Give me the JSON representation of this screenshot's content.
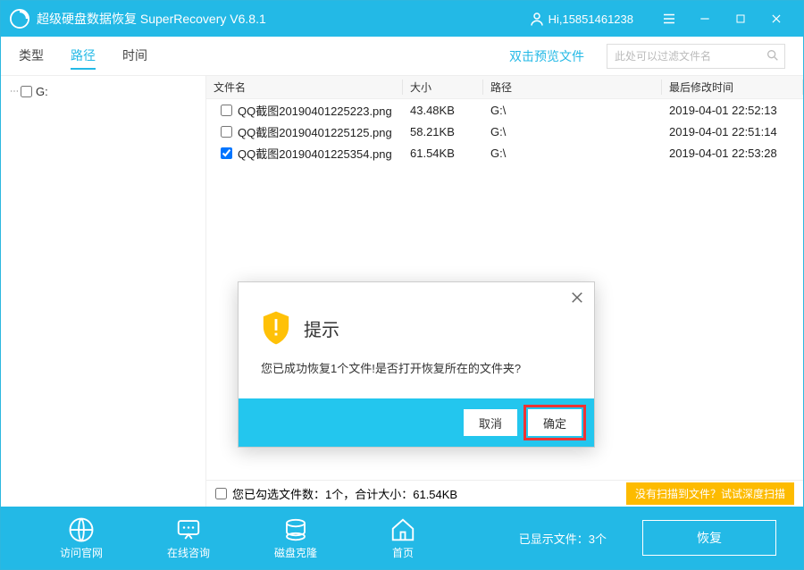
{
  "titlebar": {
    "app_title": "超级硬盘数据恢复 SuperRecovery V6.8.1",
    "user_label": "Hi,15851461238"
  },
  "toolbar": {
    "tabs": [
      "类型",
      "路径",
      "时间"
    ],
    "active_tab_index": 1,
    "preview_link": "双击预览文件",
    "search_placeholder": "此处可以过滤文件名"
  },
  "sidebar": {
    "drive_label": "G:"
  },
  "columns": {
    "name": "文件名",
    "size": "大小",
    "path": "路径",
    "date": "最后修改时间"
  },
  "rows": [
    {
      "checked": false,
      "name": "QQ截图20190401225223.png",
      "size": "43.48KB",
      "path": "G:\\",
      "date": "2019-04-01 22:52:13"
    },
    {
      "checked": false,
      "name": "QQ截图20190401225125.png",
      "size": "58.21KB",
      "path": "G:\\",
      "date": "2019-04-01 22:51:14"
    },
    {
      "checked": true,
      "name": "QQ截图20190401225354.png",
      "size": "61.54KB",
      "path": "G:\\",
      "date": "2019-04-01 22:53:28"
    }
  ],
  "summary": {
    "text": "您已勾选文件数：1个，合计大小：61.54KB",
    "deepscan": "没有扫描到文件？试试深度扫描"
  },
  "bottombar": {
    "items": [
      "访问官网",
      "在线咨询",
      "磁盘克隆",
      "首页"
    ],
    "count_label": "已显示文件：3个",
    "restore_label": "恢复"
  },
  "dialog": {
    "title": "提示",
    "message": "您已成功恢复1个文件!是否打开恢复所在的文件夹?",
    "cancel": "取消",
    "ok": "确定"
  }
}
